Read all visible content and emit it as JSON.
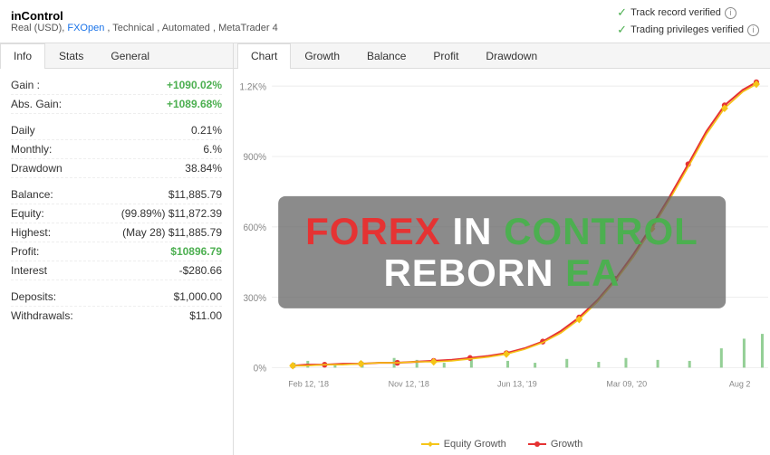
{
  "header": {
    "title": "inControl",
    "subtitle": "Real (USD), FXOpen , Technical , Automated , MetaTrader 4",
    "broker_link": "FXOpen",
    "verified1": "Track record verified",
    "verified2": "Trading privileges verified"
  },
  "left_tabs": [
    {
      "label": "Info",
      "active": true
    },
    {
      "label": "Stats",
      "active": false
    },
    {
      "label": "General",
      "active": false
    }
  ],
  "info_rows": [
    {
      "label": "Gain :",
      "value": "+1090.02%",
      "class": "green"
    },
    {
      "label": "Abs. Gain:",
      "value": "+1089.68%",
      "class": "green"
    },
    {
      "label": "Daily",
      "value": "0.21%",
      "class": ""
    },
    {
      "label": "Monthly:",
      "value": "6.%",
      "class": ""
    },
    {
      "label": "Drawdown",
      "value": "38.84%",
      "class": ""
    },
    {
      "label": "Balance:",
      "value": "$11,885.79",
      "class": ""
    },
    {
      "label": "Equity:",
      "value": "(99.89%) $11,872.39",
      "class": ""
    },
    {
      "label": "Highest:",
      "value": "(May 28) $11,885.79",
      "class": ""
    },
    {
      "label": "Profit:",
      "value": "$10896.79",
      "class": "profit-green"
    },
    {
      "label": "Interest",
      "value": "-$280.66",
      "class": ""
    },
    {
      "label": "Deposits:",
      "value": "$1,000.00",
      "class": ""
    },
    {
      "label": "Withdrawals:",
      "value": "$11.00",
      "class": ""
    }
  ],
  "chart_tabs": [
    {
      "label": "Chart",
      "active": true
    },
    {
      "label": "Growth",
      "active": false
    },
    {
      "label": "Balance",
      "active": false
    },
    {
      "label": "Profit",
      "active": false
    },
    {
      "label": "Drawdown",
      "active": false
    }
  ],
  "chart": {
    "y_labels": [
      "1.2K%",
      "900%",
      "600%",
      "300%",
      "0%"
    ],
    "x_labels": [
      "Feb 12, '18",
      "Nov 12, '18",
      "Jun 13, '19",
      "Mar 09, '20",
      "Aug 2"
    ],
    "legend": [
      {
        "label": "Equity Growth",
        "color": "#f5c518",
        "type": "diamond"
      },
      {
        "label": "Growth",
        "color": "#e53333",
        "type": "circle"
      }
    ]
  },
  "overlay": {
    "line1_part1": "FOREX",
    "line1_part2": "IN",
    "line1_part3": "CONTROL",
    "line2_part1": "REBORN",
    "line2_part2": "EA"
  }
}
